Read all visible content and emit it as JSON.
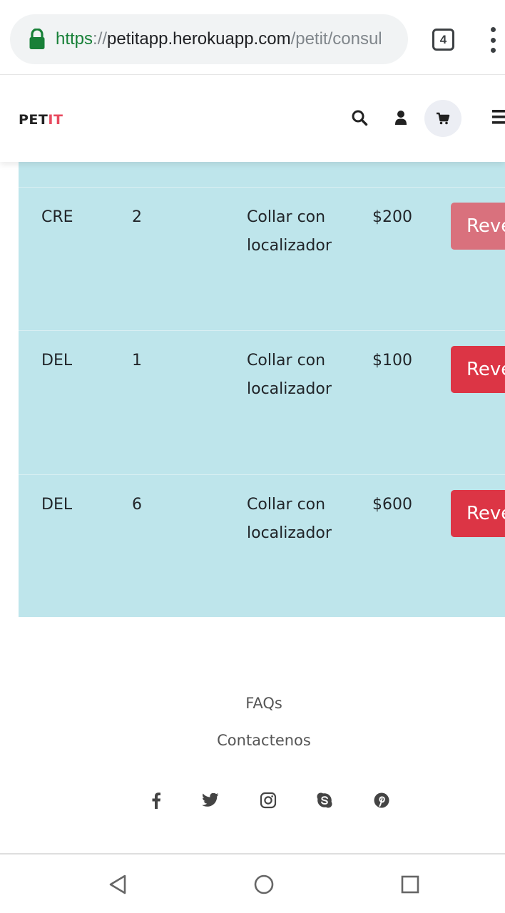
{
  "browser": {
    "url_scheme": "https",
    "url_sep": "://",
    "url_host": "petitapp.herokuapp.com",
    "url_path": "/petit/consul",
    "tab_count": "4",
    "icons": [
      "lock-icon",
      "tab-switcher-icon",
      "more-vert-icon"
    ]
  },
  "header": {
    "logo_part1": "PET",
    "logo_part2": "IT",
    "logo_colors": {
      "dark": "#222222",
      "accent": "#e84a5f"
    },
    "icons": [
      "search-icon",
      "user-icon",
      "cart-icon",
      "menu-icon"
    ]
  },
  "table": {
    "background": "#bee5eb",
    "rows": [
      {
        "code": "CRE",
        "qty": "2",
        "product": "Collar con localizador",
        "price": "$200",
        "action": "Revertir",
        "enabled": false
      },
      {
        "code": "DEL",
        "qty": "1",
        "product": "Collar con localizador",
        "price": "$100",
        "action": "Revertir",
        "enabled": true
      },
      {
        "code": "DEL",
        "qty": "6",
        "product": "Collar con localizador",
        "price": "$600",
        "action": "Revertir",
        "enabled": true
      }
    ]
  },
  "footer": {
    "links": [
      "FAQs",
      "Contactenos"
    ],
    "social_icons": [
      "facebook-icon",
      "twitter-icon",
      "instagram-icon",
      "skype-icon",
      "pinterest-icon"
    ]
  },
  "system_nav": {
    "buttons": [
      "back-icon",
      "home-icon",
      "recents-icon"
    ]
  }
}
